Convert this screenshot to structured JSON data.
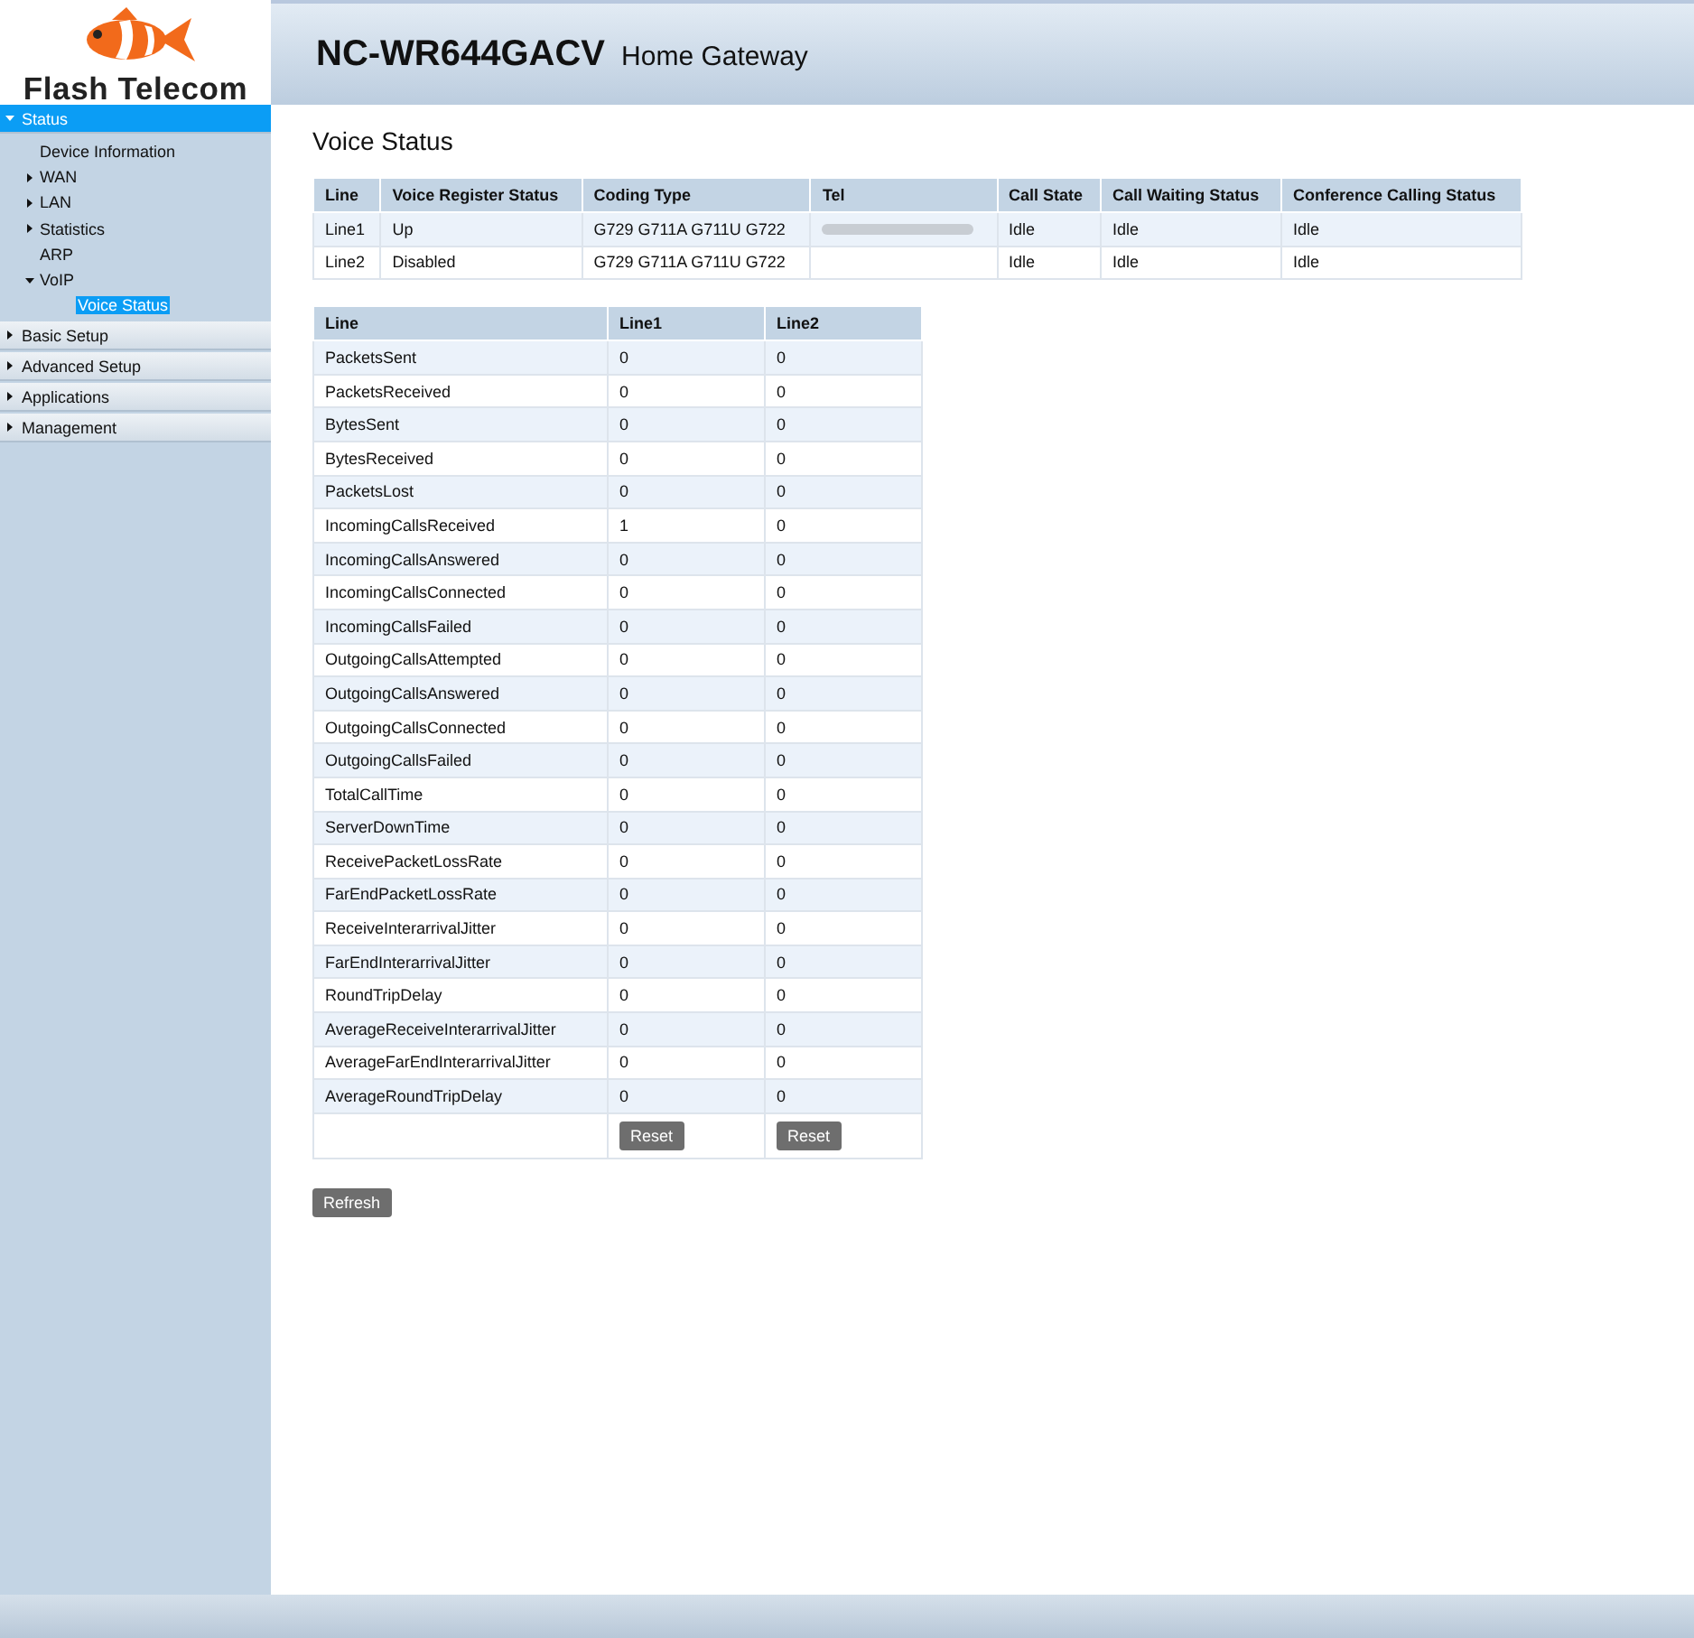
{
  "brand": {
    "name": "Flash Telecom"
  },
  "header": {
    "model": "NC-WR644GACV",
    "subtitle": "Home Gateway"
  },
  "sidebar": {
    "items": [
      {
        "label": "Status",
        "expanded": true,
        "children": [
          {
            "label": "Device Information",
            "has_children": false,
            "selected": false
          },
          {
            "label": "WAN",
            "has_children": true,
            "expanded": false,
            "selected": false
          },
          {
            "label": "LAN",
            "has_children": true,
            "expanded": false,
            "selected": false
          },
          {
            "label": "Statistics",
            "has_children": true,
            "expanded": false,
            "selected": false
          },
          {
            "label": "ARP",
            "has_children": false,
            "selected": false
          },
          {
            "label": "VoIP",
            "has_children": true,
            "expanded": true,
            "selected": false,
            "children": [
              {
                "label": "Voice Status",
                "selected": true
              }
            ]
          }
        ]
      },
      {
        "label": "Basic Setup",
        "expanded": false
      },
      {
        "label": "Advanced Setup",
        "expanded": false
      },
      {
        "label": "Applications",
        "expanded": false
      },
      {
        "label": "Management",
        "expanded": false
      }
    ]
  },
  "page_title": "Voice Status",
  "line_table": {
    "columns": [
      "Line",
      "Voice Register Status",
      "Coding Type",
      "Tel",
      "Call State",
      "Call Waiting Status",
      "Conference Calling Status"
    ],
    "rows": [
      {
        "cells": [
          "Line1",
          "Up",
          "G729 G711A G711U G722",
          null,
          "Idle",
          "Idle",
          "Idle"
        ],
        "tel_blurred": true
      },
      {
        "cells": [
          "Line2",
          "Disabled",
          "G729 G711A G711U G722",
          "",
          "Idle",
          "Idle",
          "Idle"
        ],
        "tel_blurred": false
      }
    ]
  },
  "stats_table": {
    "columns": [
      "Line",
      "Line1",
      "Line2"
    ],
    "rows": [
      [
        "PacketsSent",
        "0",
        "0"
      ],
      [
        "PacketsReceived",
        "0",
        "0"
      ],
      [
        "BytesSent",
        "0",
        "0"
      ],
      [
        "BytesReceived",
        "0",
        "0"
      ],
      [
        "PacketsLost",
        "0",
        "0"
      ],
      [
        "IncomingCallsReceived",
        "1",
        "0"
      ],
      [
        "IncomingCallsAnswered",
        "0",
        "0"
      ],
      [
        "IncomingCallsConnected",
        "0",
        "0"
      ],
      [
        "IncomingCallsFailed",
        "0",
        "0"
      ],
      [
        "OutgoingCallsAttempted",
        "0",
        "0"
      ],
      [
        "OutgoingCallsAnswered",
        "0",
        "0"
      ],
      [
        "OutgoingCallsConnected",
        "0",
        "0"
      ],
      [
        "OutgoingCallsFailed",
        "0",
        "0"
      ],
      [
        "TotalCallTime",
        "0",
        "0"
      ],
      [
        "ServerDownTime",
        "0",
        "0"
      ],
      [
        "ReceivePacketLossRate",
        "0",
        "0"
      ],
      [
        "FarEndPacketLossRate",
        "0",
        "0"
      ],
      [
        "ReceiveInterarrivalJitter",
        "0",
        "0"
      ],
      [
        "FarEndInterarrivalJitter",
        "0",
        "0"
      ],
      [
        "RoundTripDelay",
        "0",
        "0"
      ],
      [
        "AverageReceiveInterarrivalJitter",
        "0",
        "0"
      ],
      [
        "AverageFarEndInterarrivalJitter",
        "0",
        "0"
      ],
      [
        "AverageRoundTripDelay",
        "0",
        "0"
      ]
    ],
    "reset_buttons": [
      "Reset",
      "Reset"
    ]
  },
  "refresh_button": "Refresh"
}
